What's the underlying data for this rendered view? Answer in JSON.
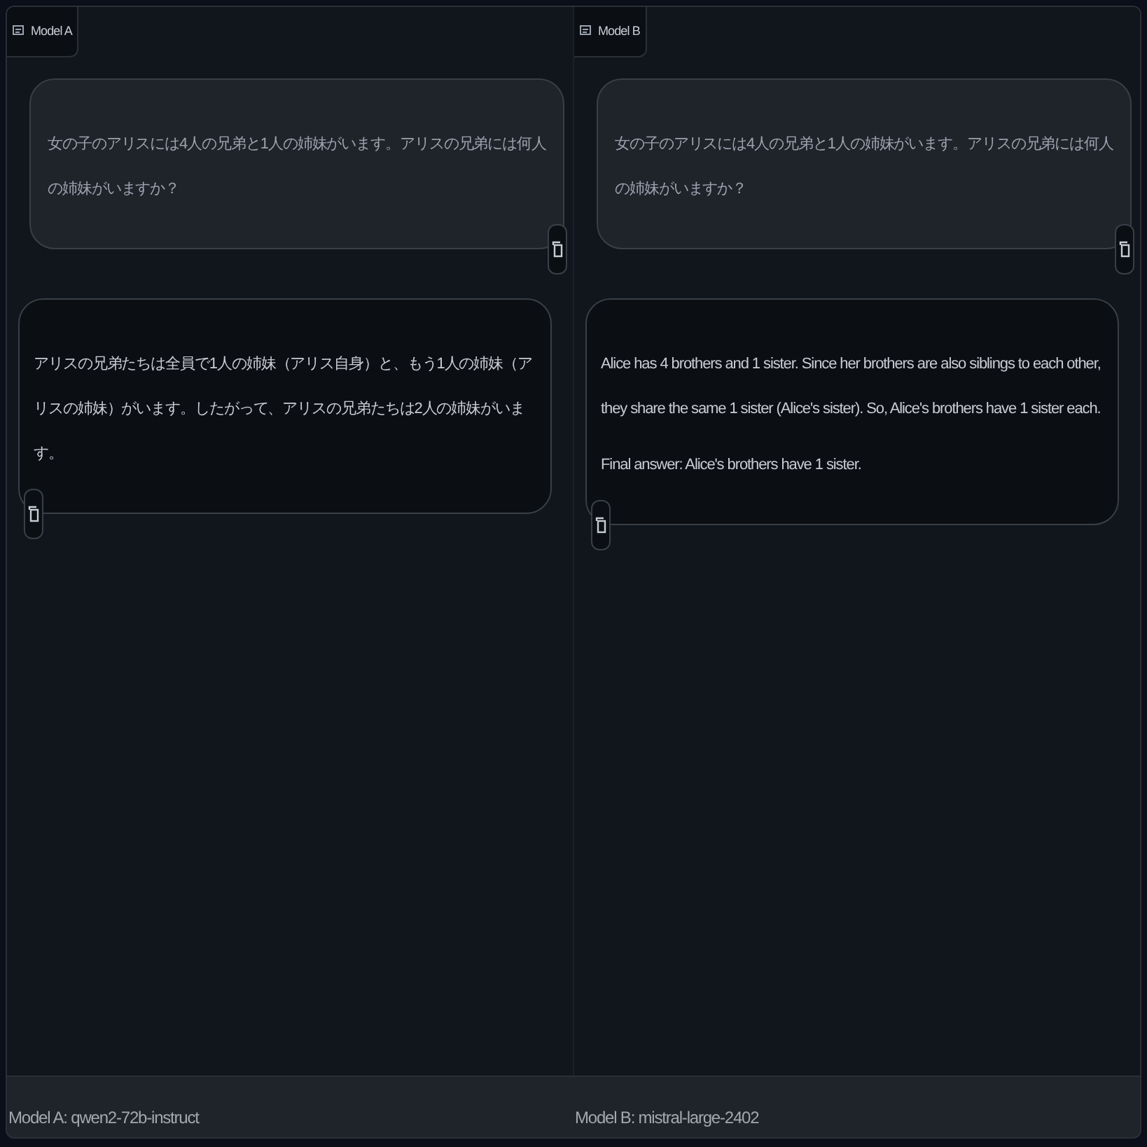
{
  "panels": [
    {
      "label": "Model A",
      "messages": [
        {
          "kind": "user",
          "paragraphs": [
            "女の子のアリスには4人の兄弟と1人の姉妹がいます。アリスの兄弟には何人の姉妹がいますか？"
          ]
        },
        {
          "kind": "bot",
          "paragraphs": [
            "アリスの兄弟たちは全員で1人の姉妹（アリス自身）と、もう1人の姉妹（アリスの姉妹）がいます。したがって、アリスの兄弟たちは2人の姉妹がいます。"
          ]
        }
      ]
    },
    {
      "label": "Model B",
      "messages": [
        {
          "kind": "user",
          "paragraphs": [
            "女の子のアリスには4人の兄弟と1人の姉妹がいます。アリスの兄弟には何人の姉妹がいますか？"
          ]
        },
        {
          "kind": "bot",
          "paragraphs": [
            "Alice has 4 brothers and 1 sister. Since her brothers are also siblings to each other, they share the same 1 sister (Alice's sister). So, Alice's brothers have 1 sister each.",
            "Final answer: Alice's brothers have 1 sister."
          ]
        }
      ]
    }
  ],
  "footer": [
    "Model A: qwen2-72b-instruct",
    "Model B: mistral-large-2402"
  ]
}
